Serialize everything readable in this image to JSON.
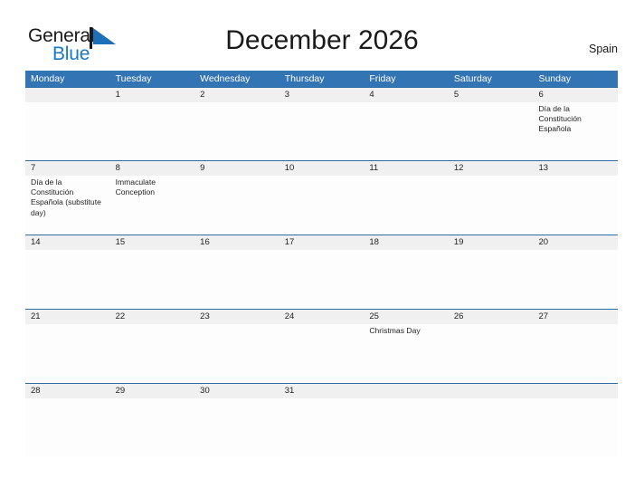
{
  "brand": {
    "name_part1": "General",
    "name_part2": "Blue",
    "flag_icon": "flag-triangle-icon",
    "accent_color": "#1878c8"
  },
  "header": {
    "title": "December 2026",
    "country": "Spain",
    "header_bg_color": "#3374b5",
    "row_band_color": "#f0f0f0",
    "row_border_color": "#2e6da4"
  },
  "weekdays": [
    "Monday",
    "Tuesday",
    "Wednesday",
    "Thursday",
    "Friday",
    "Saturday",
    "Sunday"
  ],
  "weeks": [
    {
      "days": [
        {
          "num": "",
          "events": []
        },
        {
          "num": "1",
          "events": []
        },
        {
          "num": "2",
          "events": []
        },
        {
          "num": "3",
          "events": []
        },
        {
          "num": "4",
          "events": []
        },
        {
          "num": "5",
          "events": []
        },
        {
          "num": "6",
          "events": [
            "Día de la Constitución Española"
          ]
        }
      ]
    },
    {
      "days": [
        {
          "num": "7",
          "events": [
            "Día de la Constitución Española (substitute day)"
          ]
        },
        {
          "num": "8",
          "events": [
            "Immaculate Conception"
          ]
        },
        {
          "num": "9",
          "events": []
        },
        {
          "num": "10",
          "events": []
        },
        {
          "num": "11",
          "events": []
        },
        {
          "num": "12",
          "events": []
        },
        {
          "num": "13",
          "events": []
        }
      ]
    },
    {
      "days": [
        {
          "num": "14",
          "events": []
        },
        {
          "num": "15",
          "events": []
        },
        {
          "num": "16",
          "events": []
        },
        {
          "num": "17",
          "events": []
        },
        {
          "num": "18",
          "events": []
        },
        {
          "num": "19",
          "events": []
        },
        {
          "num": "20",
          "events": []
        }
      ]
    },
    {
      "days": [
        {
          "num": "21",
          "events": []
        },
        {
          "num": "22",
          "events": []
        },
        {
          "num": "23",
          "events": []
        },
        {
          "num": "24",
          "events": []
        },
        {
          "num": "25",
          "events": [
            "Christmas Day"
          ]
        },
        {
          "num": "26",
          "events": []
        },
        {
          "num": "27",
          "events": []
        }
      ]
    },
    {
      "days": [
        {
          "num": "28",
          "events": []
        },
        {
          "num": "29",
          "events": []
        },
        {
          "num": "30",
          "events": []
        },
        {
          "num": "31",
          "events": []
        },
        {
          "num": "",
          "events": []
        },
        {
          "num": "",
          "events": []
        },
        {
          "num": "",
          "events": []
        }
      ]
    }
  ]
}
